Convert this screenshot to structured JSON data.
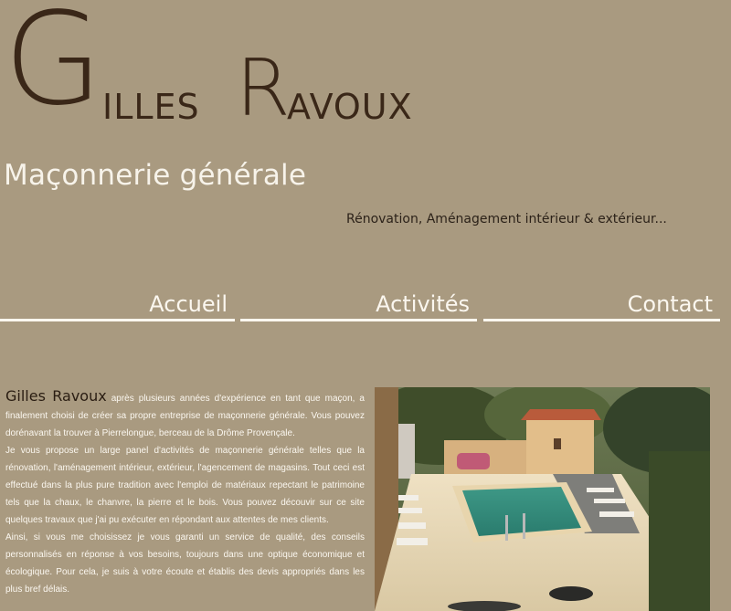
{
  "logo": {
    "g": "G",
    "illes": "ILLES",
    "r": "R",
    "avoux": "AVOUX"
  },
  "header": {
    "subtitle": "Maçonnerie générale",
    "tagline": "Rénovation, Aménagement intérieur & extérieur..."
  },
  "nav": {
    "items": [
      {
        "label": "Accueil"
      },
      {
        "label": "Activités"
      },
      {
        "label": "Contact"
      }
    ]
  },
  "content": {
    "name": "Gilles Ravoux",
    "intro": " après plusieurs années d'expérience en tant que maçon, a finalement choisi de créer sa propre entreprise de maçonnerie générale. Vous pouvez dorénavant la trouver à Pierrelongue, berceau de la Drôme Provençale.",
    "para2": "Je vous propose un large panel d'activités de maçonnerie générale telles que la rénovation, l'aménagement intérieur, extérieur, l'agencement de magasins. Tout ceci est effectué dans la plus pure tradition avec l'emploi de matériaux repectant le patrimoine tels que la chaux, le chanvre, la pierre et le bois. Vous pouvez découvir sur ce site quelques travaux que j'ai pu exécuter en répondant aux attentes de mes clients.",
    "para3": "Ainsi, si vous me choisissez je vous garanti un service de qualité, des conseils personnalisés en réponse à vos besoins, toujours dans une optique économique et écologique. Pour cela, je suis à votre écoute et établis des devis appropriés dans les plus bref délais."
  },
  "colors": {
    "background": "#a99a80",
    "logo": "#3a2718",
    "nav_text": "#fbf7ef",
    "pool_water": "#2f8a7a"
  }
}
